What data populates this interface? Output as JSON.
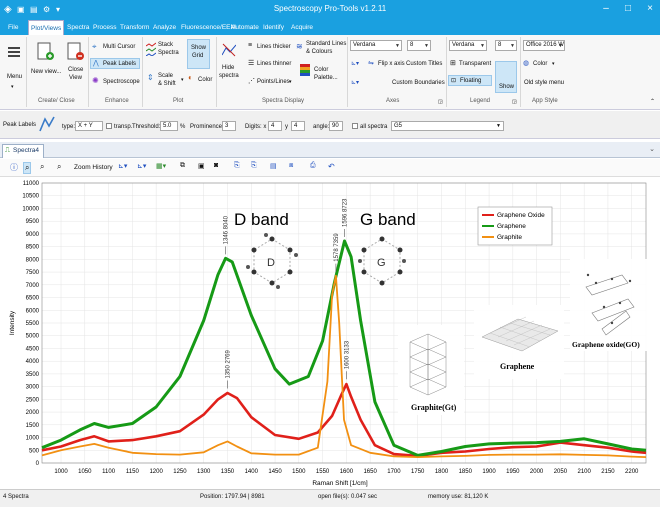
{
  "app": {
    "title": "Spectroscopy Pro-Tools  v1.2.11",
    "close": "×"
  },
  "menu": {
    "tabs": [
      "File",
      "Plot/Views",
      "Spectra",
      "Process",
      "Transform",
      "Analyze",
      "Fluorescence/EEM",
      "Automate",
      "Identify",
      "Acquire"
    ],
    "active": 1
  },
  "ribbon": {
    "menu_label": "Menu",
    "new_view": "New view...",
    "close_view_1": "Close",
    "close_view_2": "View",
    "multi_cursor": "Multi Cursor",
    "peak_labels": "Peak Labels",
    "spectroscope": "Spectroscope",
    "stack_1": "Stack",
    "stack_2": "Spectra",
    "show_grid_1": "Show",
    "show_grid_2": "Grid",
    "scale_1": "Scale",
    "scale_2": "& Shift",
    "color": "Color",
    "hide_1": "Hide",
    "hide_2": "spectra",
    "lines_thicker": "Lines thicker",
    "lines_thinner": "Lines thinner",
    "points_lines": "Points/Lines",
    "standard_1": "Standard Lines",
    "standard_2": "& Colours",
    "palette_1": "Color",
    "palette_2": "Palette...",
    "font_axes": "Verdana",
    "size_axes": "8",
    "flip_x": "Flip x axis",
    "custom_titles": "Custom Titles",
    "custom_boundaries": "Custom Boundaries",
    "font_legend": "Verdana",
    "size_legend": "8",
    "transparent": "Transparent",
    "floating": "Floating",
    "show": "Show",
    "style_combo": "Office 2016 W",
    "style_color": "Color",
    "old_style": "Old style menu",
    "groups": [
      "Create/ Close",
      "Enhance",
      "Plot",
      "Spectra Display",
      "Axes",
      "Legend",
      "App Style"
    ]
  },
  "peak_bar": {
    "title": "Peak Labels",
    "type_label": "type:",
    "type_value": "X + Y",
    "transp": "transp.",
    "threshold_label": "Threshold:",
    "threshold_value": "5.0",
    "threshold_unit": "%",
    "prominence_label": "Prominence:",
    "prominence_value": "3",
    "digits_label": "Digits: x",
    "digits_x": "4",
    "digits_y_label": "y",
    "digits_y": "4",
    "angle_label": "angle:",
    "angle_value": "90",
    "all_spectra": "all spectra",
    "spectrum_value": "G5"
  },
  "doc": {
    "tab": "Spectra4"
  },
  "plot_tools": {
    "zoom_history": "Zoom History"
  },
  "status": {
    "spectra": "4 Spectra",
    "position": "Position:  1797.94  |  8981",
    "open_files": "open file(s): 0.047 sec",
    "memory": "memory use: 81,120 K"
  },
  "colors": {
    "titlebar": "#1aa0e0",
    "oxide": "#e0201a",
    "graphene": "#169a16",
    "graphite": "#f29012"
  },
  "chart_data": {
    "type": "line",
    "xlabel": "Raman Shift [1/cm]",
    "ylabel": "Intensity",
    "xlim": [
      960,
      2230
    ],
    "ylim": [
      0,
      11000
    ],
    "x_ticks": [
      1000,
      1050,
      1100,
      1150,
      1200,
      1250,
      1300,
      1350,
      1400,
      1450,
      1500,
      1550,
      1600,
      1650,
      1700,
      1750,
      1800,
      1850,
      1900,
      1950,
      2000,
      2050,
      2100,
      2150,
      2200
    ],
    "y_ticks": [
      0,
      500,
      1000,
      1500,
      2000,
      2500,
      3000,
      3500,
      4000,
      4500,
      5000,
      5500,
      6000,
      6500,
      7000,
      7500,
      8000,
      8500,
      9000,
      9500,
      10000,
      10500,
      11000
    ],
    "grid": true,
    "legend_position": "top-right",
    "series": [
      {
        "name": "Graphene Oxide",
        "color": "#e0201a",
        "points": [
          [
            960,
            500
          ],
          [
            1000,
            650
          ],
          [
            1040,
            900
          ],
          [
            1070,
            1050
          ],
          [
            1100,
            850
          ],
          [
            1150,
            900
          ],
          [
            1200,
            1050
          ],
          [
            1250,
            1250
          ],
          [
            1300,
            1900
          ],
          [
            1330,
            2500
          ],
          [
            1350,
            2750
          ],
          [
            1370,
            2550
          ],
          [
            1400,
            1800
          ],
          [
            1450,
            1100
          ],
          [
            1500,
            950
          ],
          [
            1540,
            1200
          ],
          [
            1570,
            1850
          ],
          [
            1590,
            2700
          ],
          [
            1600,
            3100
          ],
          [
            1610,
            2600
          ],
          [
            1630,
            1700
          ],
          [
            1660,
            700
          ],
          [
            1700,
            350
          ],
          [
            1750,
            280
          ],
          [
            1800,
            400
          ],
          [
            1850,
            450
          ],
          [
            1900,
            550
          ],
          [
            1950,
            620
          ],
          [
            2000,
            650
          ],
          [
            2050,
            800
          ],
          [
            2100,
            700
          ],
          [
            2150,
            600
          ],
          [
            2200,
            450
          ],
          [
            2230,
            400
          ]
        ]
      },
      {
        "name": "Graphene",
        "color": "#169a16",
        "points": [
          [
            960,
            600
          ],
          [
            1000,
            900
          ],
          [
            1040,
            1300
          ],
          [
            1070,
            1550
          ],
          [
            1100,
            1400
          ],
          [
            1150,
            1550
          ],
          [
            1200,
            2200
          ],
          [
            1250,
            3400
          ],
          [
            1300,
            5600
          ],
          [
            1330,
            7400
          ],
          [
            1346,
            8040
          ],
          [
            1360,
            7900
          ],
          [
            1400,
            5800
          ],
          [
            1450,
            3700
          ],
          [
            1480,
            3100
          ],
          [
            1520,
            3400
          ],
          [
            1550,
            4800
          ],
          [
            1575,
            7100
          ],
          [
            1596,
            8723
          ],
          [
            1610,
            8100
          ],
          [
            1630,
            5600
          ],
          [
            1660,
            2400
          ],
          [
            1700,
            700
          ],
          [
            1750,
            300
          ],
          [
            1800,
            450
          ],
          [
            1850,
            650
          ],
          [
            1900,
            750
          ],
          [
            1950,
            780
          ],
          [
            2000,
            800
          ],
          [
            2050,
            850
          ],
          [
            2100,
            950
          ],
          [
            2150,
            750
          ],
          [
            2200,
            550
          ],
          [
            2230,
            500
          ]
        ]
      },
      {
        "name": "Graphite",
        "color": "#f29012",
        "points": [
          [
            960,
            300
          ],
          [
            1000,
            500
          ],
          [
            1040,
            650
          ],
          [
            1070,
            750
          ],
          [
            1100,
            600
          ],
          [
            1150,
            400
          ],
          [
            1200,
            350
          ],
          [
            1250,
            330
          ],
          [
            1300,
            420
          ],
          [
            1330,
            700
          ],
          [
            1350,
            850
          ],
          [
            1370,
            650
          ],
          [
            1400,
            380
          ],
          [
            1450,
            330
          ],
          [
            1500,
            330
          ],
          [
            1540,
            600
          ],
          [
            1560,
            3200
          ],
          [
            1570,
            6600
          ],
          [
            1578,
            7359
          ],
          [
            1585,
            5500
          ],
          [
            1595,
            1700
          ],
          [
            1610,
            700
          ],
          [
            1650,
            400
          ],
          [
            1700,
            260
          ],
          [
            1750,
            230
          ],
          [
            1800,
            260
          ],
          [
            1850,
            280
          ],
          [
            1900,
            320
          ],
          [
            1950,
            330
          ],
          [
            2000,
            330
          ],
          [
            2050,
            340
          ],
          [
            2100,
            320
          ],
          [
            2150,
            300
          ],
          [
            2200,
            250
          ],
          [
            2230,
            230
          ]
        ]
      }
    ],
    "peak_labels": [
      {
        "x": 1346,
        "y": 8040,
        "text": "1346  8040",
        "color": "#169a16"
      },
      {
        "x": 1350,
        "y": 2769,
        "text": "1350  2769",
        "color": "#e0201a"
      },
      {
        "x": 1578,
        "y": 7359,
        "text": "1578  7359",
        "color": "#f29012"
      },
      {
        "x": 1596,
        "y": 8723,
        "text": "1596  8723",
        "color": "#169a16"
      },
      {
        "x": 1600,
        "y": 3133,
        "text": "1600  3133",
        "color": "#e0201a"
      }
    ],
    "annotations": {
      "d_band": "D band",
      "g_band": "G band",
      "d_letter": "D",
      "g_letter": "G",
      "graphite_label": "Graphite(Gt)",
      "graphene_label": "Graphene",
      "go_label": "Graphene oxide(GO)"
    }
  }
}
